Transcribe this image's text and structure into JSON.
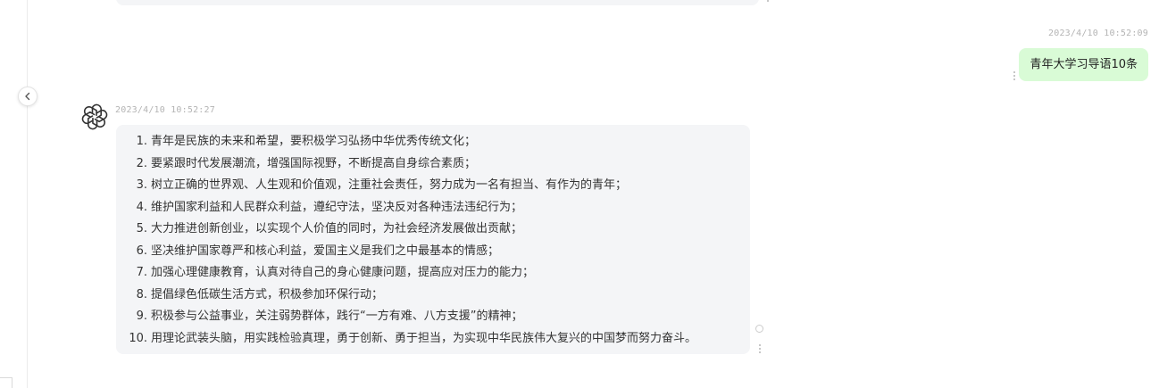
{
  "conversation": {
    "user_message": {
      "timestamp": "2023/4/10 10:52:09",
      "text": "青年大学习导语10条"
    },
    "assistant_message": {
      "timestamp": "2023/4/10 10:52:27",
      "avatar_icon": "openai-logo-icon",
      "items": [
        {
          "num": "1.",
          "text": "青年是民族的未来和希望，要积极学习弘扬中华优秀传统文化；"
        },
        {
          "num": "2.",
          "text": "要紧跟时代发展潮流，增强国际视野，不断提高自身综合素质；"
        },
        {
          "num": "3.",
          "text": "树立正确的世界观、人生观和价值观，注重社会责任，努力成为一名有担当、有作为的青年；"
        },
        {
          "num": "4.",
          "text": "维护国家利益和人民群众利益，遵纪守法，坚决反对各种违法违纪行为；"
        },
        {
          "num": "5.",
          "text": "大力推进创新创业，以实现个人价值的同时，为社会经济发展做出贡献；"
        },
        {
          "num": "6.",
          "text": "坚决维护国家尊严和核心利益，爱国主义是我们之中最基本的情感；"
        },
        {
          "num": "7.",
          "text": "加强心理健康教育，认真对待自己的身心健康问题，提高应对压力的能力；"
        },
        {
          "num": "8.",
          "text": "提倡绿色低碳生活方式，积极参加环保行动；"
        },
        {
          "num": "9.",
          "text": "积极参与公益事业，关注弱势群体，践行“一方有难、八方支援”的精神；"
        },
        {
          "num": "10.",
          "text": "用理论武装头脑，用实践检验真理，勇于创新、勇于担当，为实现中华民族伟大复兴的中国梦而努力奋斗。"
        }
      ]
    }
  },
  "colors": {
    "user_bubble": "#d9fbd6",
    "assistant_bubble": "#f4f5f7",
    "timestamp": "#b4b4b4",
    "text": "#333333"
  },
  "icons": {
    "collapse": "chevron-left-icon",
    "more": "more-vertical-icon",
    "loading": "loading-ring-icon"
  }
}
